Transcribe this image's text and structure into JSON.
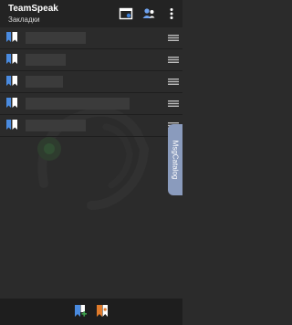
{
  "app": {
    "title": "TeamSpeak",
    "subtitle": "Закладки"
  },
  "actions": [
    "connect-screen-icon",
    "contacts-icon",
    "more-vert-icon"
  ],
  "bookmarks": [
    {
      "name": ""
    },
    {
      "name": ""
    },
    {
      "name": ""
    },
    {
      "name": ""
    },
    {
      "name": ""
    }
  ],
  "side_tab": {
    "label": "MsgCatalog"
  },
  "bottom_actions": [
    "add-bookmark-icon",
    "history-icon"
  ],
  "colors": {
    "background": "#2b2b2b",
    "appbar": "#232323",
    "bookmark_icon": "#3d7fd6",
    "side_tab": "#8a9bbd",
    "accent_orange": "#e07b2b",
    "accent_green": "#3fa34d"
  }
}
